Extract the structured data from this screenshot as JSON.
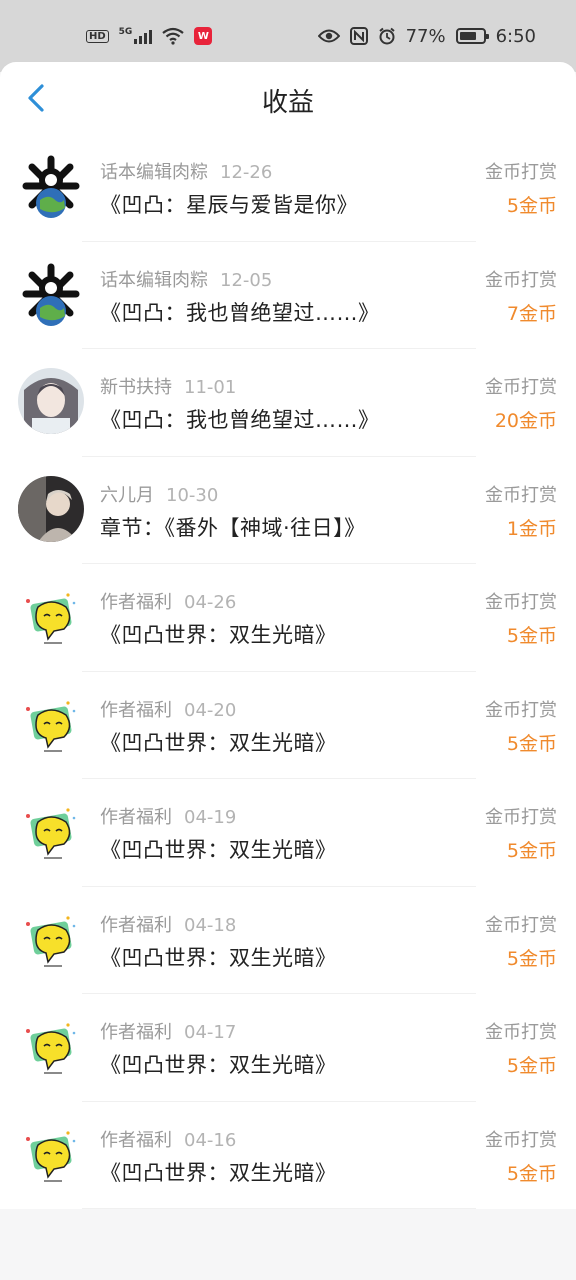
{
  "status_bar": {
    "hd": "HD",
    "network": "5G",
    "app_badge": "W",
    "battery": "77%",
    "time": "6:50"
  },
  "header": {
    "title": "收益"
  },
  "colors": {
    "accent_back": "#2e8fd8",
    "amount": "#f08a2d"
  },
  "records": [
    {
      "avatar": "editor-avatar",
      "source": "话本编辑肉粽",
      "date": "12-26",
      "item": "《凹凸：星辰与爱皆是你》",
      "type": "金币打赏",
      "amount": "5金币"
    },
    {
      "avatar": "editor-avatar",
      "source": "话本编辑肉粽",
      "date": "12-05",
      "item": "《凹凸：我也曾绝望过……》",
      "type": "金币打赏",
      "amount": "7金币"
    },
    {
      "avatar": "portrait-avatar",
      "source": "新书扶持",
      "date": "11-01",
      "item": "《凹凸：我也曾绝望过……》",
      "type": "金币打赏",
      "amount": "20金币"
    },
    {
      "avatar": "photo-avatar",
      "source": "六儿月",
      "date": "10-30",
      "item": "章节：《番外【神域·往日】》",
      "type": "金币打赏",
      "amount": "1金币"
    },
    {
      "avatar": "mascot-avatar",
      "source": "作者福利",
      "date": "04-26",
      "item": "《凹凸世界：双生光暗》",
      "type": "金币打赏",
      "amount": "5金币"
    },
    {
      "avatar": "mascot-avatar",
      "source": "作者福利",
      "date": "04-20",
      "item": "《凹凸世界：双生光暗》",
      "type": "金币打赏",
      "amount": "5金币"
    },
    {
      "avatar": "mascot-avatar",
      "source": "作者福利",
      "date": "04-19",
      "item": "《凹凸世界：双生光暗》",
      "type": "金币打赏",
      "amount": "5金币"
    },
    {
      "avatar": "mascot-avatar",
      "source": "作者福利",
      "date": "04-18",
      "item": "《凹凸世界：双生光暗》",
      "type": "金币打赏",
      "amount": "5金币"
    },
    {
      "avatar": "mascot-avatar",
      "source": "作者福利",
      "date": "04-17",
      "item": "《凹凸世界：双生光暗》",
      "type": "金币打赏",
      "amount": "5金币"
    },
    {
      "avatar": "mascot-avatar",
      "source": "作者福利",
      "date": "04-16",
      "item": "《凹凸世界：双生光暗》",
      "type": "金币打赏",
      "amount": "5金币"
    }
  ]
}
